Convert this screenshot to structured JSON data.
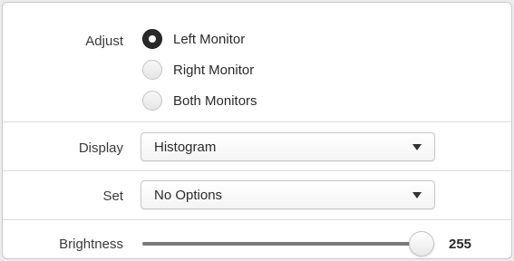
{
  "adjust": {
    "label": "Adjust",
    "options": [
      {
        "label": "Left Monitor",
        "checked": true
      },
      {
        "label": "Right Monitor",
        "checked": false
      },
      {
        "label": "Both Monitors",
        "checked": false
      }
    ]
  },
  "display": {
    "label": "Display",
    "value": "Histogram"
  },
  "set": {
    "label": "Set",
    "value": "No Options"
  },
  "brightness": {
    "label": "Brightness",
    "value": "255",
    "fraction": 1.0
  },
  "colors": {
    "selected_radio": "#2a2a2a",
    "panel_background": "#ffffff",
    "divider": "#dcdcdc"
  },
  "icons": {
    "dropdown": "chevron-down-icon"
  }
}
